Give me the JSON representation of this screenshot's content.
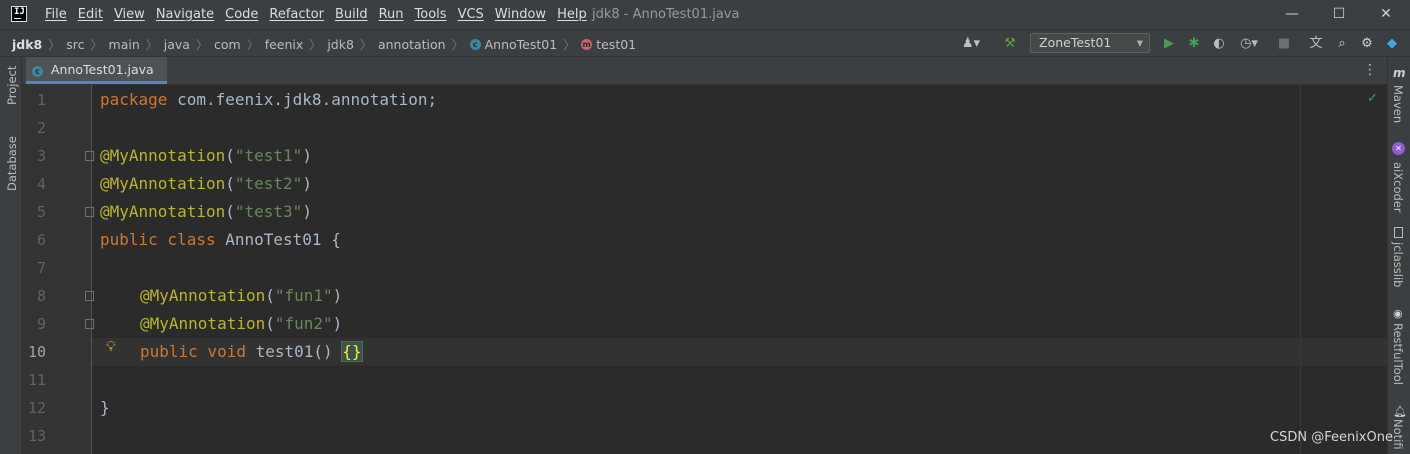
{
  "title_bar": {
    "menu": [
      "File",
      "Edit",
      "View",
      "Navigate",
      "Code",
      "Refactor",
      "Build",
      "Run",
      "Tools",
      "VCS",
      "Window",
      "Help"
    ],
    "window_title": "jdk8 - AnnoTest01.java",
    "controls": [
      "—",
      "☐",
      "✕"
    ]
  },
  "nav": {
    "breadcrumbs": [
      "jdk8",
      "src",
      "main",
      "java",
      "com",
      "feenix",
      "jdk8",
      "annotation"
    ],
    "class_crumb": "AnnoTest01",
    "method_crumb": "test01",
    "run_config": "ZoneTest01"
  },
  "left_tools": [
    "Project",
    "Database"
  ],
  "right_tools": [
    "Maven",
    "aiXcoder",
    "jclasslib",
    "RestfulTool",
    "Notifi"
  ],
  "tab": {
    "label": "AnnoTest01.java",
    "close": "×"
  },
  "line_numbers": [
    "1",
    "2",
    "3",
    "4",
    "5",
    "6",
    "7",
    "8",
    "9",
    "10",
    "11",
    "12",
    "13"
  ],
  "current_line": "10",
  "code": {
    "l1": {
      "kw": "package",
      "rest": " com.feenix.jdk8.annotation;"
    },
    "l3": {
      "ann": "@MyAnnotation",
      "open": "(",
      "str": "\"test1\"",
      "close": ")"
    },
    "l4": {
      "ann": "@MyAnnotation",
      "open": "(",
      "str": "\"test2\"",
      "close": ")"
    },
    "l5": {
      "ann": "@MyAnnotation",
      "open": "(",
      "str": "\"test3\"",
      "close": ")"
    },
    "l6": {
      "kw": "public class",
      "rest": " AnnoTest01 {"
    },
    "l8": {
      "ann": "@MyAnnotation",
      "open": "(",
      "str": "\"fun1\"",
      "close": ")"
    },
    "l9": {
      "ann": "@MyAnnotation",
      "open": "(",
      "str": "\"fun2\"",
      "close": ")"
    },
    "l10": {
      "kw": "public void",
      "rest": " test01() ",
      "brace": "{}"
    },
    "l12": {
      "rest": "}"
    }
  },
  "watermark": "CSDN @FeenixOne",
  "colors": {
    "keyword": "#cc7832",
    "annotation": "#bbb529",
    "string": "#6a8759",
    "text": "#a9b7c6",
    "accent": "#4a88c7"
  }
}
